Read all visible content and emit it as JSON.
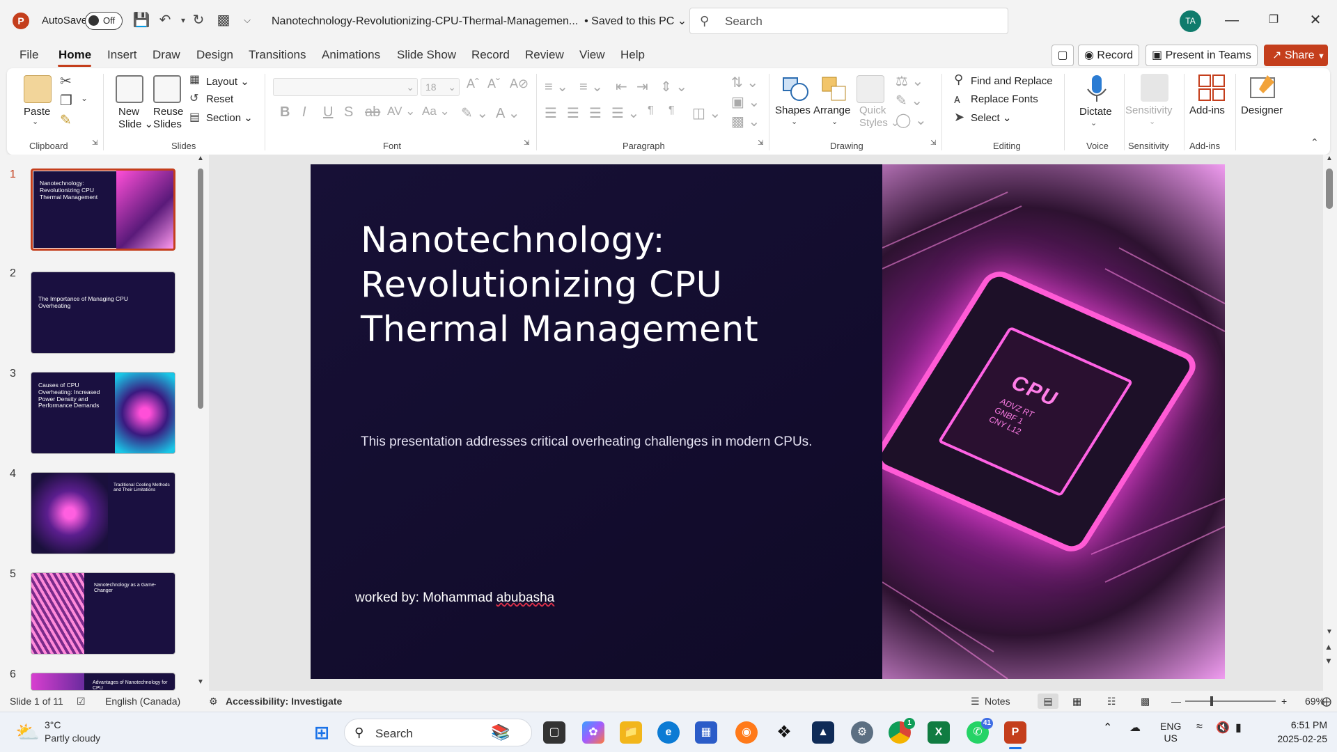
{
  "app": {
    "logo_letter": "P",
    "autosave_label": "AutoSave",
    "autosave_state": "Off",
    "doc_title": "Nanotechnology-Revolutionizing-CPU-Thermal-Managemen...",
    "save_status": "• Saved to this PC",
    "search_placeholder": "Search",
    "user_initials": "TA"
  },
  "tabs": [
    "File",
    "Home",
    "Insert",
    "Draw",
    "Design",
    "Transitions",
    "Animations",
    "Slide Show",
    "Record",
    "Review",
    "View",
    "Help"
  ],
  "active_tab": "Home",
  "top_buttons": {
    "record": "Record",
    "present": "Present in Teams",
    "share": "Share"
  },
  "ribbon": {
    "clipboard": {
      "paste": "Paste",
      "label": "Clipboard"
    },
    "slides": {
      "new_slide": "New\nSlide",
      "new": "New",
      "slide": "Slide",
      "reuse": "Reuse",
      "slides": "Slides",
      "layout": "Layout",
      "reset": "Reset",
      "section": "Section",
      "label": "Slides"
    },
    "font": {
      "size": "18",
      "label": "Font"
    },
    "paragraph": {
      "label": "Paragraph"
    },
    "drawing": {
      "shapes": "Shapes",
      "arrange": "Arrange",
      "quick": "Quick",
      "styles": "Styles",
      "label": "Drawing"
    },
    "editing": {
      "find_replace": "Find and Replace",
      "replace_fonts": "Replace Fonts",
      "select": "Select",
      "label": "Editing"
    },
    "voice": {
      "dictate": "Dictate",
      "label": "Voice"
    },
    "sensitivity": {
      "button": "Sensitivity",
      "label": "Sensitivity"
    },
    "addins": {
      "button": "Add-ins",
      "label": "Add-ins"
    },
    "designer": {
      "button": "Designer"
    }
  },
  "thumbnails": [
    {
      "num": "1",
      "title": "Nanotechnology: Revolutionizing CPU Thermal Management"
    },
    {
      "num": "2",
      "title": "The Importance of Managing CPU Overheating"
    },
    {
      "num": "3",
      "title": "Causes of CPU Overheating: Increased Power Density and Performance Demands"
    },
    {
      "num": "4",
      "title": "Traditional Cooling Methods and Their Limitations"
    },
    {
      "num": "5",
      "title": "Nanotechnology as a Game-Changer"
    },
    {
      "num": "6",
      "title": "Advantages of Nanotechnology for CPU"
    }
  ],
  "slide": {
    "title": "Nanotechnology: Revolutionizing CPU Thermal Management",
    "subtitle": "This presentation addresses critical overheating challenges in modern CPUs.",
    "author_prefix": "worked by: Mohammad ",
    "author_name": "abubasha",
    "chip_label": "CPU",
    "chip_small": "ADVZ RT\nGNBF 1\nCNY L12"
  },
  "status": {
    "slide_count": "Slide 1 of 11",
    "language": "English (Canada)",
    "accessibility": "Accessibility: Investigate",
    "notes": "Notes",
    "zoom": "69%"
  },
  "taskbar": {
    "temp": "3°C",
    "weather": "Partly cloudy",
    "search": "Search",
    "chrome_badge": "1",
    "whatsapp_badge": "41",
    "lang1": "ENG",
    "lang2": "US",
    "time": "6:51 PM",
    "date": "2025-02-25"
  },
  "colors": {
    "accent": "#c43e1c",
    "slide_bg": "#150e33",
    "chip_pink": "#ff5bd6"
  }
}
